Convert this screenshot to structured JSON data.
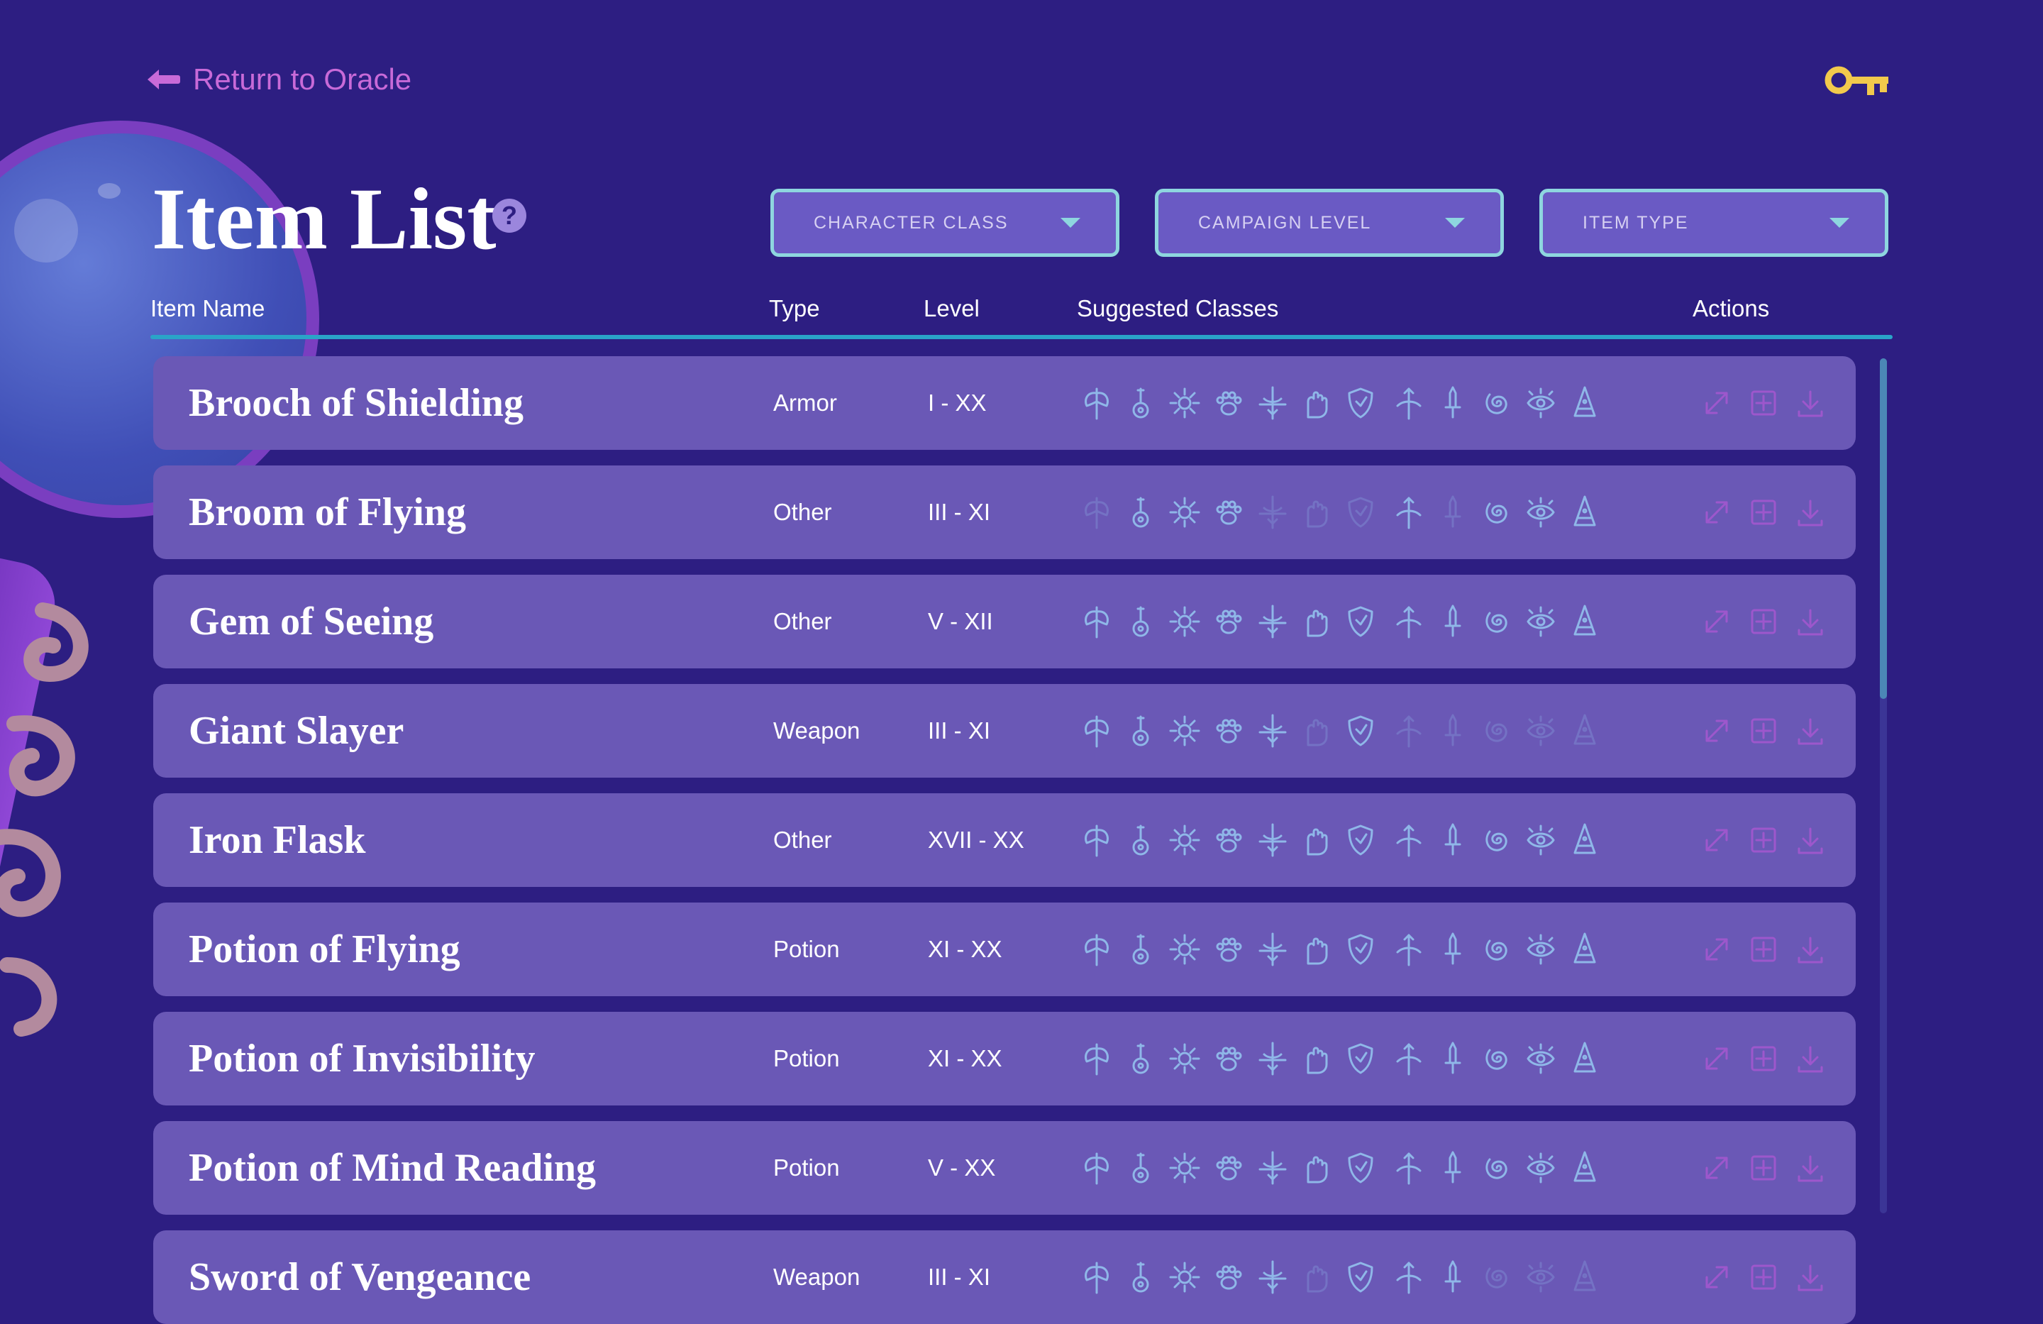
{
  "nav": {
    "back_label": "Return to Oracle"
  },
  "page": {
    "title": "Item List",
    "help_glyph": "?"
  },
  "filters": [
    {
      "label": "CHARACTER CLASS"
    },
    {
      "label": "CAMPAIGN LEVEL"
    },
    {
      "label": "ITEM TYPE"
    }
  ],
  "columns": {
    "name": "Item Name",
    "type": "Type",
    "level": "Level",
    "classes": "Suggested Classes",
    "actions": "Actions"
  },
  "class_icons": [
    "barbarian-axe-icon",
    "bard-lute-icon",
    "cleric-sun-icon",
    "druid-paw-icon",
    "fighter-sword-icon",
    "monk-fist-icon",
    "paladin-shield-icon",
    "ranger-bow-icon",
    "rogue-dagger-icon",
    "sorcerer-swirl-icon",
    "warlock-eye-icon",
    "wizard-hat-icon"
  ],
  "items": [
    {
      "name": "Brooch of Shielding",
      "type": "Armor",
      "level": "I - XX",
      "classes_active": [
        true,
        true,
        true,
        true,
        true,
        true,
        true,
        true,
        true,
        true,
        true,
        true
      ]
    },
    {
      "name": "Broom of Flying",
      "type": "Other",
      "level": "III - XI",
      "classes_active": [
        false,
        true,
        true,
        true,
        false,
        false,
        false,
        true,
        false,
        true,
        true,
        true
      ]
    },
    {
      "name": "Gem of Seeing",
      "type": "Other",
      "level": "V - XII",
      "classes_active": [
        true,
        true,
        true,
        true,
        true,
        true,
        true,
        true,
        true,
        true,
        true,
        true
      ]
    },
    {
      "name": "Giant Slayer",
      "type": "Weapon",
      "level": "III - XI",
      "classes_active": [
        true,
        true,
        true,
        true,
        true,
        false,
        true,
        false,
        false,
        false,
        false,
        false
      ]
    },
    {
      "name": "Iron Flask",
      "type": "Other",
      "level": "XVII - XX",
      "classes_active": [
        true,
        true,
        true,
        true,
        true,
        true,
        true,
        true,
        true,
        true,
        true,
        true
      ]
    },
    {
      "name": "Potion of Flying",
      "type": "Potion",
      "level": "XI - XX",
      "classes_active": [
        true,
        true,
        true,
        true,
        true,
        true,
        true,
        true,
        true,
        true,
        true,
        true
      ]
    },
    {
      "name": "Potion of Invisibility",
      "type": "Potion",
      "level": "XI - XX",
      "classes_active": [
        true,
        true,
        true,
        true,
        true,
        true,
        true,
        true,
        true,
        true,
        true,
        true
      ]
    },
    {
      "name": "Potion of Mind Reading",
      "type": "Potion",
      "level": "V - XX",
      "classes_active": [
        true,
        true,
        true,
        true,
        true,
        true,
        true,
        true,
        true,
        true,
        true,
        true
      ]
    },
    {
      "name": "Sword of Vengeance",
      "type": "Weapon",
      "level": "III - XI",
      "classes_active": [
        true,
        true,
        true,
        true,
        true,
        false,
        true,
        true,
        true,
        false,
        false,
        false
      ]
    }
  ],
  "actions": [
    "expand-icon",
    "add-icon",
    "download-icon"
  ],
  "colors": {
    "background": "#2d1e82",
    "row": "#6a58b6",
    "accent_teal": "#8ed6df",
    "accent_magenta": "#c86ad8",
    "key_gold": "#f2c94c"
  }
}
